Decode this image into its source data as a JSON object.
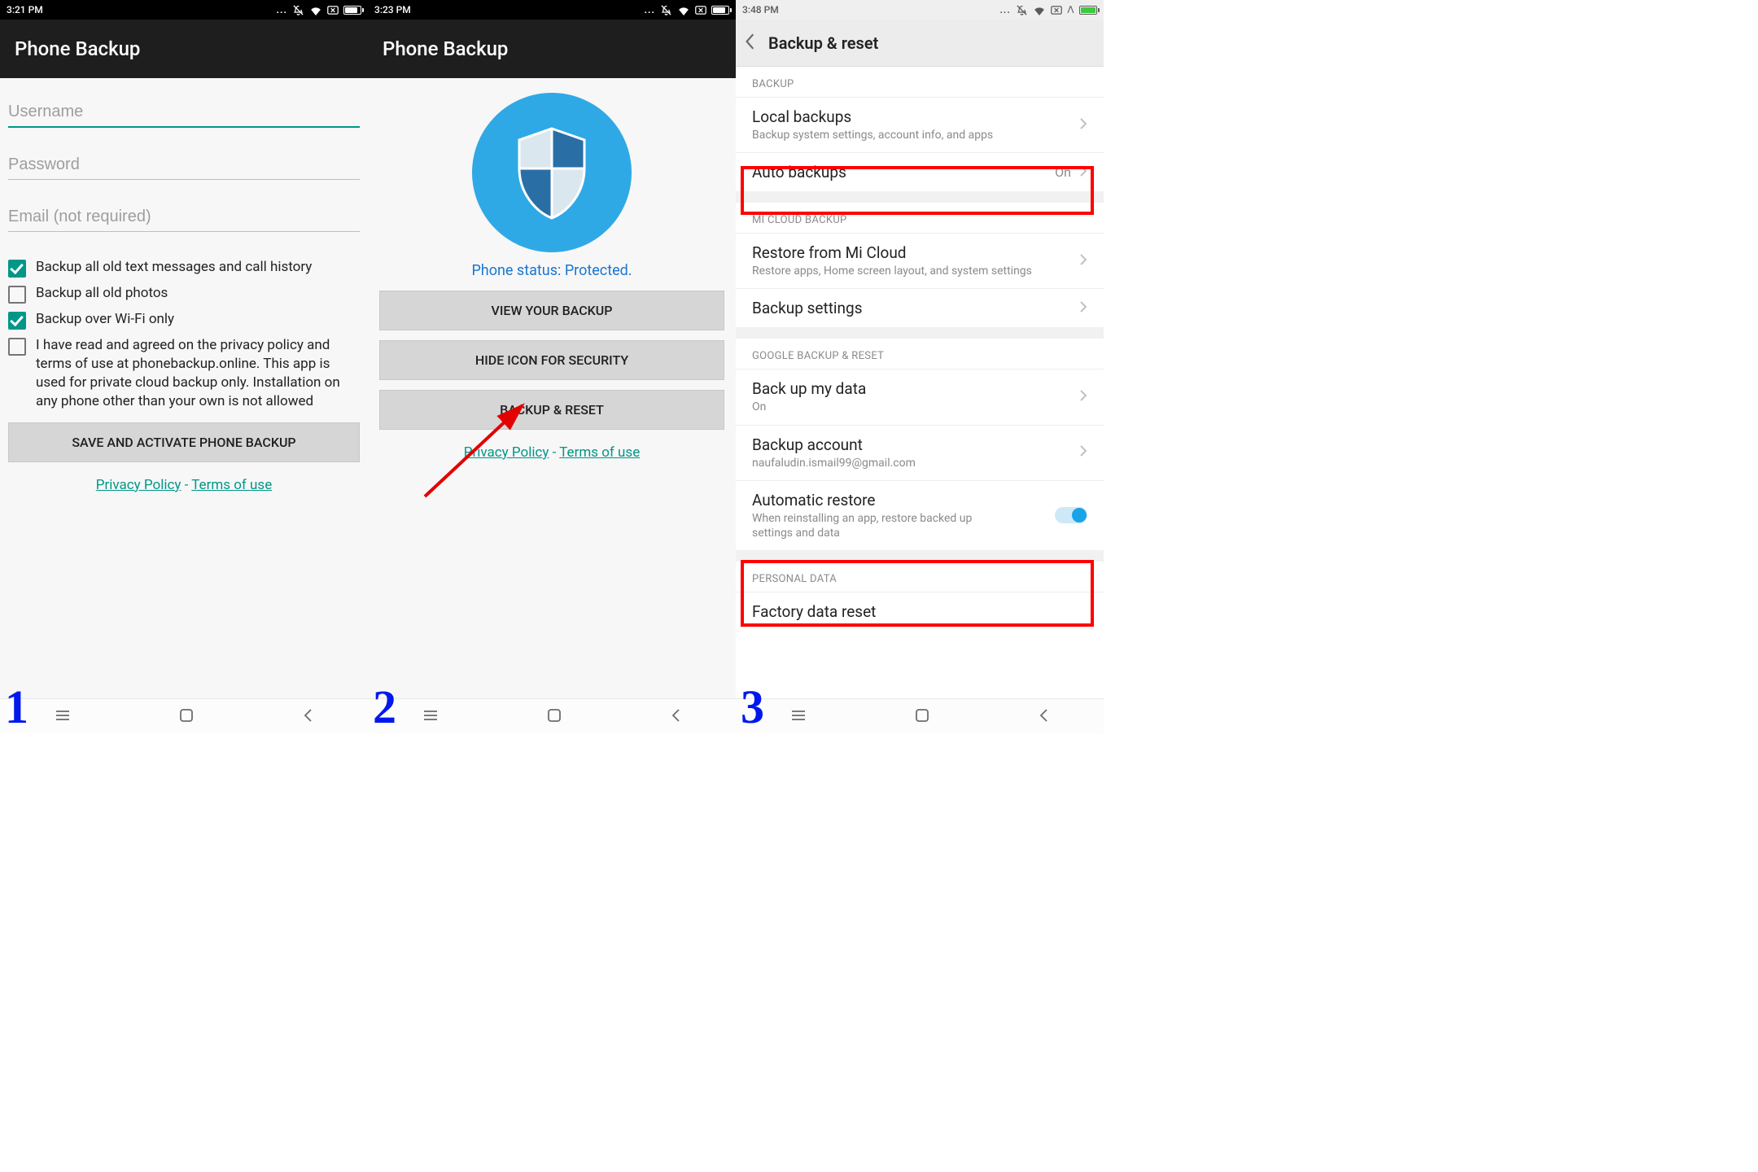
{
  "screen1": {
    "time": "3:21 PM",
    "header": "Phone Backup",
    "username_placeholder": "Username",
    "password_placeholder": "Password",
    "email_placeholder": "Email (not required)",
    "cb1": "Backup all old text messages and call history",
    "cb2": "Backup all old photos",
    "cb3": "Backup over Wi-Fi only",
    "cb4": "I have read and agreed on the privacy policy and terms of use at phonebackup.online. This app is used for private cloud backup only. Installation on any phone other than your own is not allowed",
    "save_btn": "SAVE AND ACTIVATE PHONE BACKUP",
    "privacy": "Privacy Policy",
    "dash": " - ",
    "terms": "Terms of use",
    "stepnum": "1"
  },
  "screen2": {
    "time": "3:23 PM",
    "header": "Phone Backup",
    "status": "Phone status: Protected.",
    "btn1": "VIEW YOUR BACKUP",
    "btn2": "HIDE ICON FOR SECURITY",
    "btn3": "BACKUP & RESET",
    "privacy": "Privacy Policy",
    "dash": " - ",
    "terms": "Terms of use",
    "stepnum": "2"
  },
  "screen3": {
    "time": "3:48 PM",
    "header": "Backup & reset",
    "sec_backup": "BACKUP",
    "local_title": "Local backups",
    "local_sub": "Backup system settings, account info, and apps",
    "auto_title": "Auto backups",
    "auto_value": "On",
    "sec_micloud": "MI CLOUD BACKUP",
    "restore_title": "Restore from Mi Cloud",
    "restore_sub": "Restore apps, Home screen layout, and system settings",
    "backup_settings": "Backup settings",
    "sec_google": "GOOGLE BACKUP & RESET",
    "backup_data_title": "Back up my data",
    "backup_data_sub": "On",
    "backup_account_title": "Backup account",
    "backup_account_sub": "naufaludin.ismail99@gmail.com",
    "auto_restore_title": "Automatic restore",
    "auto_restore_sub": "When reinstalling an app, restore backed up settings and data",
    "sec_personal": "PERSONAL DATA",
    "factory": "Factory data reset",
    "stepnum": "3"
  }
}
